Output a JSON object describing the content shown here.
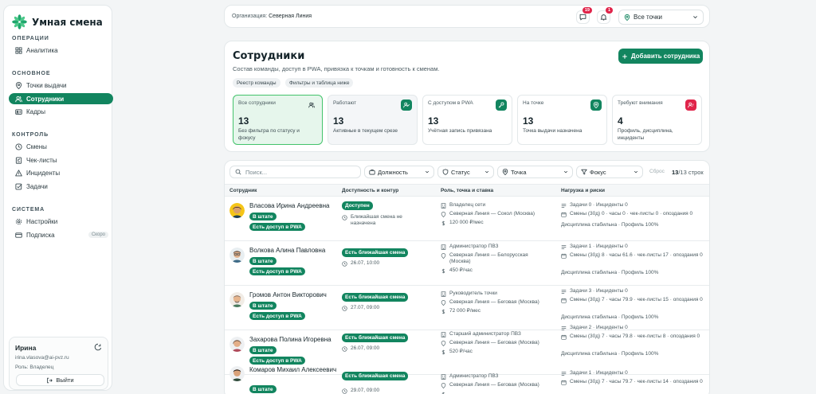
{
  "app": {
    "name": "Умная смена",
    "brand_color": "#12855f"
  },
  "sidebar": {
    "sections": [
      {
        "label": "ОПЕРАЦИИ",
        "items": [
          {
            "label": "Аналитика",
            "icon": "grid-icon"
          }
        ]
      },
      {
        "label": "ОСНОВНОЕ",
        "items": [
          {
            "label": "Точки выдачи",
            "icon": "map-pin-icon"
          },
          {
            "label": "Сотрудники",
            "icon": "users-icon",
            "active": true
          },
          {
            "label": "Кадры",
            "icon": "id-card-icon"
          }
        ]
      },
      {
        "label": "КОНТРОЛЬ",
        "items": [
          {
            "label": "Смены",
            "icon": "clock-icon"
          },
          {
            "label": "Чек-листы",
            "icon": "checklist-icon"
          },
          {
            "label": "Инциденты",
            "icon": "warning-icon"
          },
          {
            "label": "Задачи",
            "icon": "checkbox-icon"
          }
        ]
      },
      {
        "label": "СИСТЕМА",
        "items": [
          {
            "label": "Настройки",
            "icon": "gear-icon"
          },
          {
            "label": "Подписка",
            "icon": "card-icon",
            "badge": "Скоро"
          }
        ]
      }
    ],
    "user": {
      "name": "Ирина",
      "email": "irina.vlasova@ai-pvz.ru",
      "role": "Роль: Владелец",
      "logout_label": "Выйти"
    }
  },
  "topbar": {
    "org_label": "Организация:",
    "org_name": "Северная Линия",
    "messages_count": "19",
    "notifications_count": "1",
    "point_select": "Все точки"
  },
  "header": {
    "title": "Сотрудники",
    "subtitle": "Состав команды, доступ в PWA, привязка к точкам и готовность к сменам.",
    "chips": [
      "Реестр команды",
      "Фильтры и таблица ниже"
    ],
    "add_button": "Добавить сотрудника"
  },
  "stats": [
    {
      "label": "Все сотрудники",
      "value": "13",
      "desc": "Без фильтра по статусу и фокусу",
      "icon": "users-icon",
      "selected": true
    },
    {
      "label": "Работают",
      "value": "13",
      "desc": "Активные в текущем срезе",
      "icon": "user-check-icon"
    },
    {
      "label": "С доступом в PWA",
      "value": "13",
      "desc": "Учётная запись привязана",
      "icon": "key-icon"
    },
    {
      "label": "На точке",
      "value": "13",
      "desc": "Точка выдачи назначена",
      "icon": "map-pin-icon"
    },
    {
      "label": "Требуют внимания",
      "value": "4",
      "desc": "Профиль, дисциплина, инциденты",
      "icon": "user-alert-icon"
    }
  ],
  "filters": {
    "search_placeholder": "Поиск...",
    "selects": [
      "Должность",
      "Статус",
      "Точка",
      "Фокус"
    ],
    "reset_label": "Сброс",
    "count": "13",
    "count_suffix": "/13 строк"
  },
  "table": {
    "headers": [
      "Сотрудник",
      "Доступность и контур",
      "Роль, точка и ставка",
      "Нагрузка и риски"
    ],
    "rows": [
      {
        "name": "Власова Ирина Андреевна",
        "badges": [
          "В штате",
          "Есть доступ в PWA"
        ],
        "status": "Доступен",
        "shift": "Ближайшая смена не назначена",
        "role": "Владелец сети",
        "point": "Северная Линия — Сокол (Москва)",
        "rate": "120 000 ₽/мес",
        "tasks": "Задачи 0 · Инциденты 0",
        "shifts": "Смены (30д) 0 · часы 0 · чек-листы 0 · опоздания 0",
        "discipline": "Дисциплина стабильна · Профиль 100%"
      },
      {
        "name": "Волкова Алина Павловна",
        "badges": [
          "В штате",
          "Есть доступ в PWA"
        ],
        "status": "Есть ближайшая смена",
        "shift": "26.07, 10:00",
        "role": "Администратор ПВЗ",
        "point": "Северная Линия — Белорусская (Москва)",
        "rate": "450 ₽/час",
        "tasks": "Задачи 1 · Инциденты 0",
        "shifts": "Смены (30д) 8 · часы 61.6 · чек-листы 17 · опоздания 0",
        "discipline": "Дисциплина стабильна · Профиль 100%"
      },
      {
        "name": "Громов Антон Викторович",
        "badges": [
          "В штате",
          "Есть доступ в PWA"
        ],
        "status": "Есть ближайшая смена",
        "shift": "27.07, 09:00",
        "role": "Руководитель точки",
        "point": "Северная Линия — Беговая (Москва)",
        "rate": "72 000 ₽/мес",
        "tasks": "Задачи 3 · Инциденты 0",
        "shifts": "Смены (30д) 7 · часы 79.9 · чек-листы 15 · опоздания 0",
        "discipline": "Дисциплина стабильна · Профиль 100%"
      },
      {
        "name": "Захарова Полина Игоревна",
        "badges": [
          "В штате",
          "Есть доступ в PWA"
        ],
        "status": "Есть ближайшая смена",
        "shift": "26.07, 09:00",
        "role": "Старший администратор ПВЗ",
        "point": "Северная Линия — Беговая (Москва)",
        "rate": "520 ₽/час",
        "tasks": "Задачи 2 · Инциденты 0",
        "shifts": "Смены (30д) 7 · часы 79.8 · чек-листы 8 · опоздания 0",
        "discipline": "Дисциплина стабильна · Профиль 100%"
      },
      {
        "name": "Комаров Михаил Алексеевич",
        "badges": [
          "В штате"
        ],
        "status": "Есть ближайшая смена",
        "shift": "29.07, 09:00",
        "role": "Администратор ПВЗ",
        "point": "Северная Линия — Беговая (Москва)",
        "rate": "",
        "tasks": "Задачи 1 · Инциденты 0",
        "shifts": "Смены (30д) 7 · часы 79.7 · чек-листы 14 · опоздания 0",
        "discipline": ""
      }
    ]
  }
}
